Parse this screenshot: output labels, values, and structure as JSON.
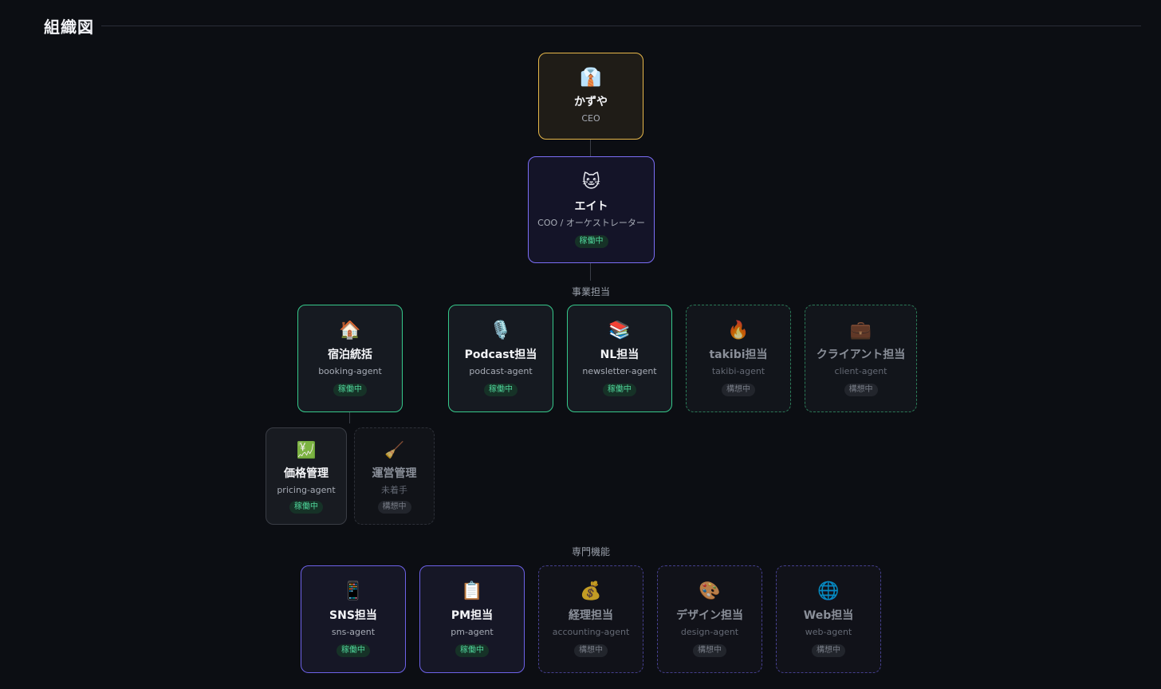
{
  "page": {
    "title": "組織図"
  },
  "ceo": {
    "icon": "👔",
    "name": "かずや",
    "role": "CEO"
  },
  "coo": {
    "icon": "🐱",
    "name": "エイト",
    "role": "COO / オーケストレーター",
    "status": "稼働中"
  },
  "business": {
    "label": "事業担当",
    "booking": {
      "icon": "🏠",
      "name": "宿泊統括",
      "role": "booking-agent",
      "status": "稼働中"
    },
    "podcast": {
      "icon": "🎙️",
      "name": "Podcast担当",
      "role": "podcast-agent",
      "status": "稼働中"
    },
    "newsletter": {
      "icon": "📚",
      "name": "NL担当",
      "role": "newsletter-agent",
      "status": "稼働中"
    },
    "takibi": {
      "icon": "🔥",
      "name": "takibi担当",
      "role": "takibi-agent",
      "status": "構想中"
    },
    "client": {
      "icon": "💼",
      "name": "クライアント担当",
      "role": "client-agent",
      "status": "構想中"
    }
  },
  "booking_sub": {
    "pricing": {
      "icon": "💹",
      "name": "価格管理",
      "role": "pricing-agent",
      "status": "稼働中"
    },
    "operations": {
      "icon": "🧹",
      "name": "運営管理",
      "role": "未着手",
      "status": "構想中"
    }
  },
  "specialist": {
    "label": "専門機能",
    "sns": {
      "icon": "📱",
      "name": "SNS担当",
      "role": "sns-agent",
      "status": "稼働中"
    },
    "pm": {
      "icon": "📋",
      "name": "PM担当",
      "role": "pm-agent",
      "status": "稼働中"
    },
    "accounting": {
      "icon": "💰",
      "name": "経理担当",
      "role": "accounting-agent",
      "status": "構想中"
    },
    "design": {
      "icon": "🎨",
      "name": "デザイン担当",
      "role": "design-agent",
      "status": "構想中"
    },
    "web": {
      "icon": "🌐",
      "name": "Web担当",
      "role": "web-agent",
      "status": "構想中"
    }
  },
  "colors": {
    "ceo": "#e8b84a",
    "coo": "#7b6ef6",
    "active_business": "#36c98b",
    "specialist": "#6d62e8",
    "active_badge": "#4fd49a"
  }
}
